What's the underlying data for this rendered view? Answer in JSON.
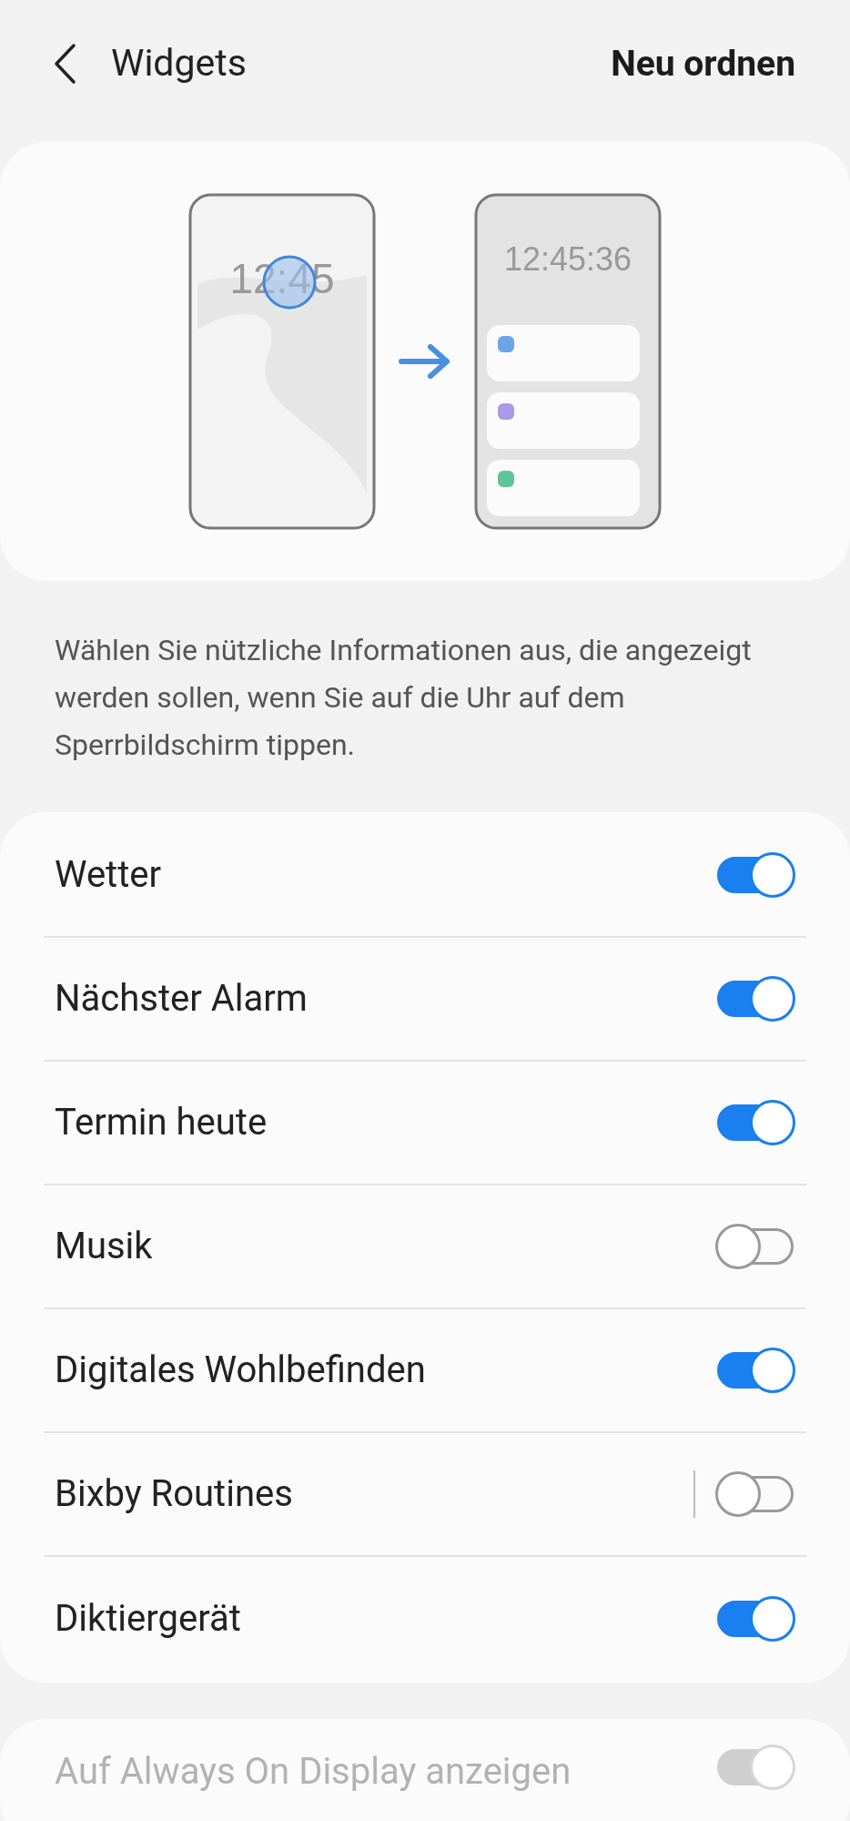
{
  "header": {
    "title": "Widgets",
    "action": "Neu ordnen"
  },
  "illustration": {
    "clock_small": "12:45",
    "clock_large": "12:45:36",
    "widget_dots": [
      {
        "color": "#6aa6e6"
      },
      {
        "color": "#a99be6"
      },
      {
        "color": "#5fc49a"
      }
    ]
  },
  "description": "Wählen Sie nützliche Informationen aus, die angezeigt werden sollen, wenn Sie auf die Uhr auf dem Sperrbildschirm tippen.",
  "widgets": [
    {
      "label": "Wetter",
      "checked": true,
      "separator": false
    },
    {
      "label": "Nächster Alarm",
      "checked": true,
      "separator": false
    },
    {
      "label": "Termin heute",
      "checked": true,
      "separator": false
    },
    {
      "label": "Musik",
      "checked": false,
      "separator": false
    },
    {
      "label": "Digitales Wohlbefinden",
      "checked": true,
      "separator": false
    },
    {
      "label": "Bixby Routines",
      "checked": false,
      "separator": true
    },
    {
      "label": "Diktiergerät",
      "checked": true,
      "separator": false
    }
  ],
  "aod": {
    "label": "Auf Always On Display anzeigen",
    "checked": true,
    "disabled": true
  }
}
